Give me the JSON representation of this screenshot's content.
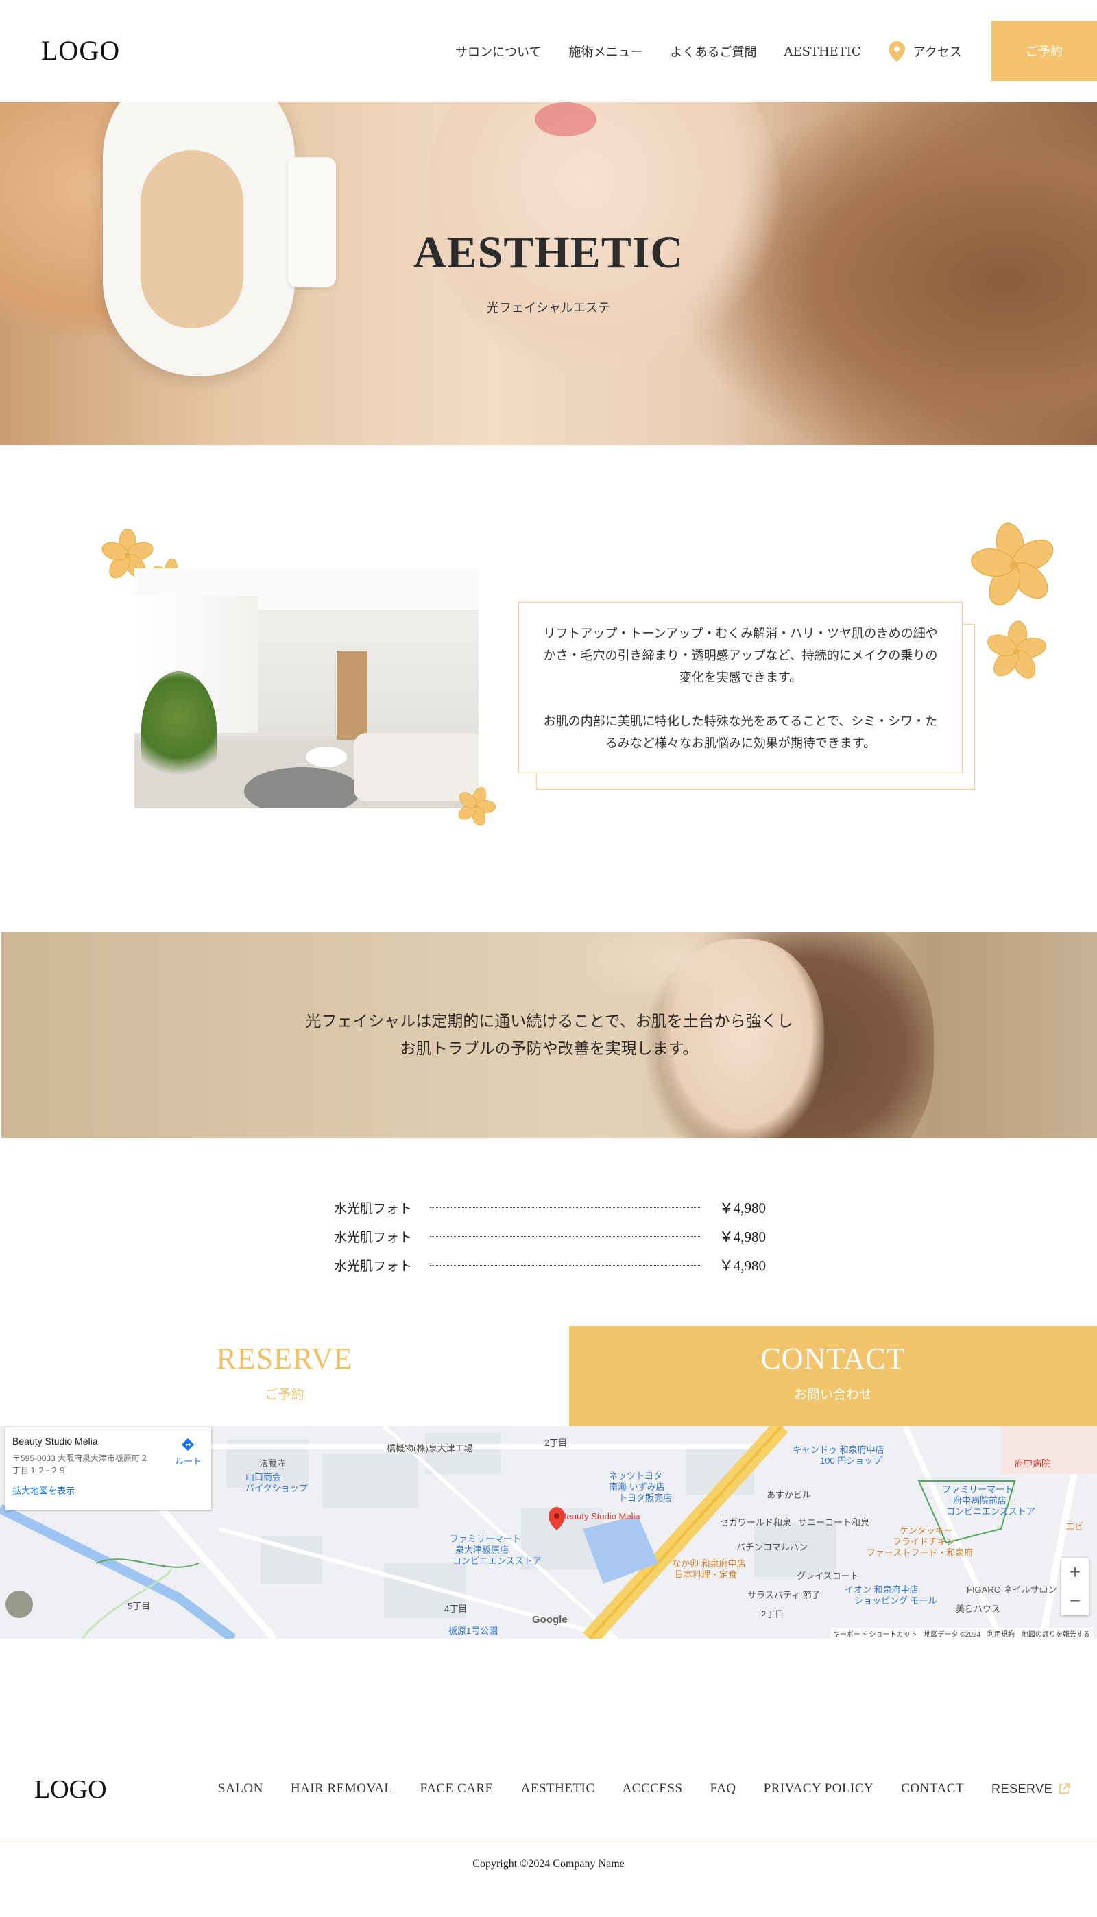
{
  "header": {
    "logo": "LOGO",
    "nav": [
      {
        "label": "サロンについて"
      },
      {
        "label": "施術メニュー"
      },
      {
        "label": "よくあるご質問"
      },
      {
        "label": "AESTHETIC"
      },
      {
        "label": "アクセス"
      }
    ],
    "reserve_label": "ご予約"
  },
  "hero": {
    "title": "AESTHETIC",
    "subtitle": "光フェイシャルエステ"
  },
  "intro": {
    "paragraph1": "リフトアップ・トーンアップ・むくみ解消・ハリ・ツヤ肌のきめの細やかさ・毛穴の引き締まり・透明感アップなど、持続的にメイクの乗りの変化を実感できます。",
    "paragraph2": "お肌の内部に美肌に特化した特殊な光をあてることで、シミ・シワ・たるみなど様々なお肌悩みに効果が期待できます。"
  },
  "banner": {
    "line1": "光フェイシャルは定期的に通い続けることで、お肌を土台から強くし",
    "line2": "お肌トラブルの予防や改善を実現します。"
  },
  "prices": [
    {
      "name": "水光肌フォト",
      "price": "￥4,980"
    },
    {
      "name": "水光肌フォト",
      "price": "￥4,980"
    },
    {
      "name": "水光肌フォト",
      "price": "￥4,980"
    }
  ],
  "cta": {
    "reserve_title": "RESERVE",
    "reserve_sub": "ご予約",
    "contact_title": "CONTACT",
    "contact_sub": "お問い合わせ"
  },
  "map": {
    "card_name": "Beauty Studio Melia",
    "card_address": "〒595-0033 大阪府泉大津市板原町２丁目１２−２９",
    "card_link": "拡大地図を表示",
    "route_label": "ルート",
    "pin_label": "Beauty Studio Melia",
    "google": "Google",
    "footer": "キーボード ショートカット　地図データ ©2024　利用規約　地図の誤りを報告する",
    "zoom_in": "+",
    "zoom_out": "−",
    "labels": {
      "factory": "橋概物(株)泉大津工場",
      "chome2": "2丁目",
      "temple": "法蔵寺",
      "yamaguchi": "山口商会",
      "bike": "バイクショップ",
      "toyota1": "ネッツトヨタ",
      "toyota2": "南海 いずみ店",
      "toyota3": "トヨタ販売店",
      "candou1": "キャンドゥ 和泉府中店",
      "candou2": "100 円ショップ",
      "hospital": "府中病院",
      "family1": "ファミリーマート",
      "family2": "泉大津板原店",
      "family3": "コンビニエンスストア",
      "family4": "ファミリーマート",
      "family5": "府中病院前店",
      "family6": "コンビニエンスストア",
      "kfc1": "ケンタッキー",
      "kfc2": "フライドチキン",
      "kfc3": "ファーストフード・和泉府",
      "nakau1": "なか卯 和泉府中店",
      "nakau2": "日本料理・定食",
      "aeon1": "イオン 和泉府中店",
      "aeon2": "ショッピング モール",
      "figaro": "FIGARO ネイルサロン",
      "chome5": "5丁目",
      "chome4": "4丁目",
      "park": "板原1号公園",
      "chome2b": "2丁目",
      "pachinko": "パチンコマルハン",
      "glacy": "グレイスコート",
      "sarasu": "サラスパティ 節子",
      "misora": "美らハウス",
      "segawa": "セガワールド和泉",
      "asukabil": "あすかビル",
      "sunny": "サニーコート和泉",
      "eb": "エビ"
    }
  },
  "footer": {
    "logo": "LOGO",
    "nav": [
      "SALON",
      "HAIR REMOVAL",
      "FACE CARE",
      "AESTHETIC",
      "ACCCESS",
      "FAQ",
      "PRIVACY POLICY",
      "CONTACT"
    ],
    "reserve": "RESERVE",
    "copyright": "Copyright ©2024 Company Name"
  },
  "colors": {
    "accent": "#f2c46c",
    "accent_text": "#f0c064",
    "flower": "#f3c46d",
    "box_border": "#f0cf8f"
  }
}
